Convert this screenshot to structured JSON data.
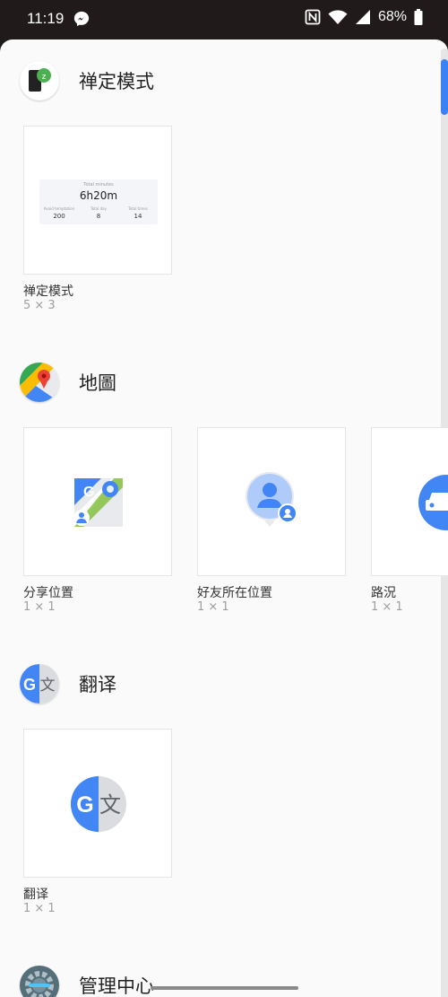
{
  "status_bar": {
    "time": "11:19",
    "battery": "68%"
  },
  "sections": [
    {
      "app_name": "禅定模式",
      "widgets": [
        {
          "label": "禅定模式",
          "size": "5 × 3",
          "preview": {
            "title": "Total minutes",
            "value": "6h20m",
            "stats": [
              {
                "label": "Avoid temptation",
                "value": "200"
              },
              {
                "label": "Total day",
                "value": "8"
              },
              {
                "label": "Total times",
                "value": "14"
              }
            ]
          }
        }
      ]
    },
    {
      "app_name": "地圖",
      "widgets": [
        {
          "label": "分享位置",
          "size": "1 × 1"
        },
        {
          "label": "好友所在位置",
          "size": "1 × 1"
        },
        {
          "label": "路況",
          "size": "1 × 1"
        }
      ]
    },
    {
      "app_name": "翻译",
      "widgets": [
        {
          "label": "翻译",
          "size": "1 × 1"
        }
      ]
    },
    {
      "app_name": "管理中心",
      "widgets": []
    }
  ],
  "colors": {
    "accent": "#3b82f6",
    "google_blue": "#4285f4",
    "google_green": "#34a853",
    "google_red": "#ea4335",
    "google_yellow": "#fbbc04"
  }
}
